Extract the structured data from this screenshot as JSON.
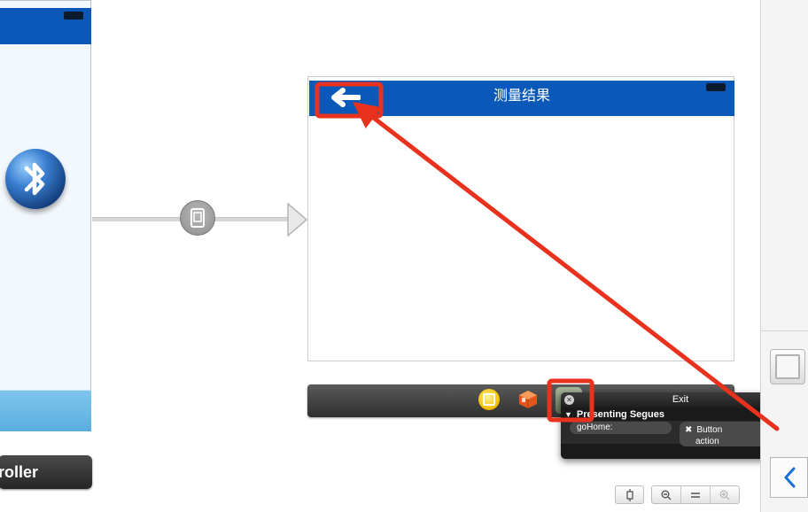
{
  "storyboard": {
    "left_scene": {
      "partial_label": "roller",
      "icon": "bluetooth-icon"
    },
    "segue": {
      "icon": "device-segue-icon"
    },
    "right_scene": {
      "nav_title": "测量结果",
      "back_icon": "back-arrow-icon"
    },
    "scene_dock": {
      "items": [
        "first-responder-icon",
        "view-controller-cube-icon",
        "exit-icon"
      ]
    }
  },
  "connections_popover": {
    "title": "Exit",
    "section": "Presenting Segues",
    "method": "goHome:",
    "connection_line1": "Button",
    "connection_line2": "action"
  },
  "zoom_controls": {
    "fit": "fit-icon",
    "zoom_out": "zoom-out-icon",
    "actual_size": "actual-size-icon",
    "zoom_in": "zoom-in-icon"
  },
  "colors": {
    "nav_bar": "#0a59b9",
    "annotation": "#e8321e",
    "tab_bar": "#6ab8e6"
  }
}
